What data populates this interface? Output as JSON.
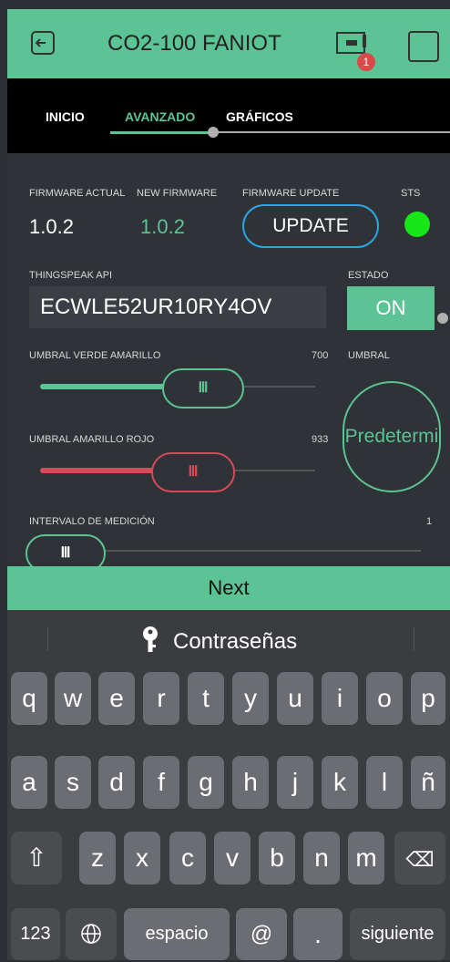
{
  "header": {
    "title": "CO2-100 FANIOT",
    "badge": "1"
  },
  "tabs": [
    {
      "label": "INICIO"
    },
    {
      "label": "AVANZADO"
    },
    {
      "label": "GRÁFICOS"
    }
  ],
  "firmware": {
    "actual_label": "FIRMWARE ACTUAL",
    "actual_value": "1.0.2",
    "new_label": "NEW FIRMWARE",
    "new_value": "1.0.2",
    "update_label": "FIRMWARE UPDATE",
    "update_button": "UPDATE",
    "sts_label": "STS"
  },
  "thingspeak": {
    "label": "THINGSPEAK API",
    "value": "ECWLE52UR10RY4OV",
    "estado_label": "ESTADO",
    "estado_button": "ON"
  },
  "umbral_verde": {
    "label": "UMBRAL VERDE AMARILLO",
    "value": "700"
  },
  "umbral_amarillo": {
    "label": "UMBRAL AMARILLO ROJO",
    "value": "933"
  },
  "umbral": {
    "label": "UMBRAL",
    "button": "Predetermi"
  },
  "intervalo": {
    "label": "INTERVALO DE MEDICIÓN",
    "value": "1"
  },
  "keyboard": {
    "next": "Next",
    "passwords": "Contraseñas",
    "row1": [
      "q",
      "w",
      "e",
      "r",
      "t",
      "y",
      "u",
      "i",
      "o",
      "p"
    ],
    "row2": [
      "a",
      "s",
      "d",
      "f",
      "g",
      "h",
      "j",
      "k",
      "l",
      "ñ"
    ],
    "row3": [
      "z",
      "x",
      "c",
      "v",
      "b",
      "n",
      "m"
    ],
    "key_123": "123",
    "space": "espacio",
    "at": "@",
    "dot": ".",
    "next_key": "siguiente"
  },
  "colors": {
    "accent": "#5cc394",
    "blue": "#2aa7e0",
    "red": "#d64a5a",
    "green_led": "#17e617"
  }
}
